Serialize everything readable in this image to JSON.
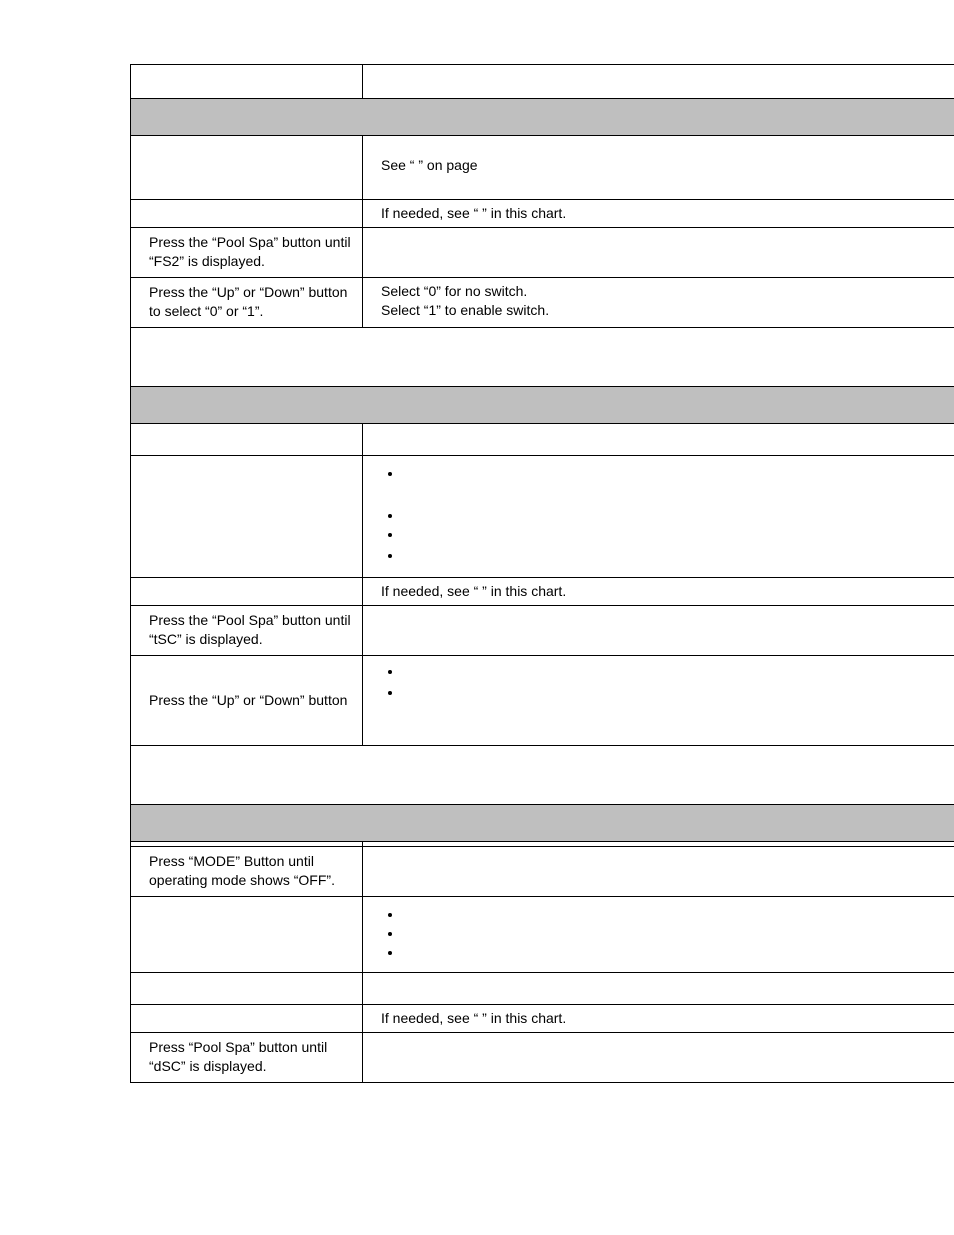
{
  "rows": {
    "r0_left": "",
    "r0_right": "",
    "r1_full": "",
    "r2_left": "",
    "r2_right": "See “                                                                          ” on page",
    "r2_right_pad": " ",
    "r3_left": "",
    "r3_right": "If needed, see “                                              ” in this chart.",
    "r4_left": "Press the “Pool  Spa” button until “FS2” is displayed.",
    "r4_right": "",
    "r5_left": "Press the “Up” or “Down” button to select “0” or “1”.",
    "r5_right_a": "Select “0” for no switch.",
    "r5_right_b": "Select “1” to enable switch.",
    "r5b_full": "",
    "r6_full": "",
    "r7_left": "",
    "r7_right": "",
    "r8_left": "",
    "r8_b1": "",
    "r8_b1_sp": " ",
    "r8_b2": "",
    "r8_b3": "",
    "r8_b4": "",
    "r9_left": "",
    "r9_right": "If needed, see “                                              ” in this chart.",
    "r10_left": "Press the “Pool  Spa” button until “tSC” is displayed.",
    "r10_right": "",
    "r11_left": "Press the “Up” or “Down” button",
    "r11_b1": "",
    "r11_b2": "",
    "r11_b2_sp": " ",
    "r12_full": "",
    "r13_full": "",
    "r14_left": "",
    "r14_right": "",
    "r15_left": "Press “MODE” Button until operating mode shows “OFF”.",
    "r15_right": "",
    "r16_left": "",
    "r16_b1": "",
    "r16_b2": "",
    "r16_b3": "",
    "r17_left": "",
    "r17_right": "",
    "r18_left": "",
    "r18_right": "If needed, see “                                              ” in this chart.",
    "r19_left": "Press “Pool  Spa” button until “dSC” is displayed.",
    "r19_right": ""
  },
  "footer": {
    "left": "",
    "right": ""
  }
}
